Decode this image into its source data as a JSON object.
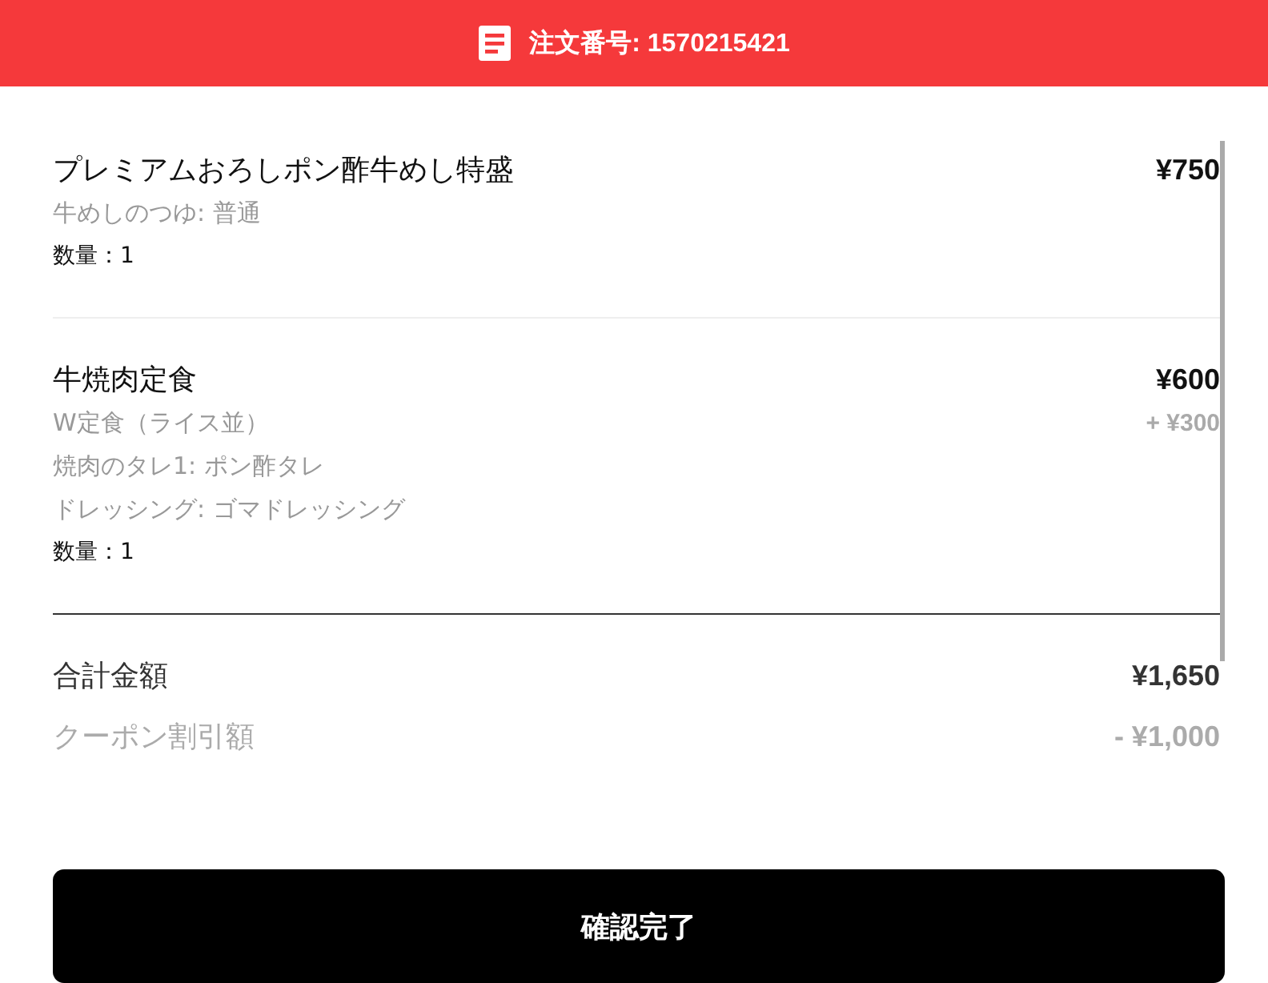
{
  "header": {
    "title": "注文番号: 1570215421"
  },
  "items": [
    {
      "name": "プレミアムおろしポン酢牛めし特盛",
      "price": "¥750",
      "options": [
        {
          "text": "牛めしのつゆ: 普通"
        }
      ],
      "quantity": "数量：1"
    },
    {
      "name": "牛焼肉定食",
      "price": "¥600",
      "options": [
        {
          "text": "W定食（ライス並）",
          "price": "+ ¥300"
        },
        {
          "text": "焼肉のタレ1: ポン酢タレ"
        },
        {
          "text": "ドレッシング: ゴマドレッシング"
        }
      ],
      "quantity": "数量：1"
    }
  ],
  "summary": [
    {
      "label": "合計金額",
      "value": "¥1,650",
      "faded": false
    },
    {
      "label": "クーポン割引額",
      "value": "- ¥1,000",
      "faded": true
    }
  ],
  "button": "確認完了"
}
